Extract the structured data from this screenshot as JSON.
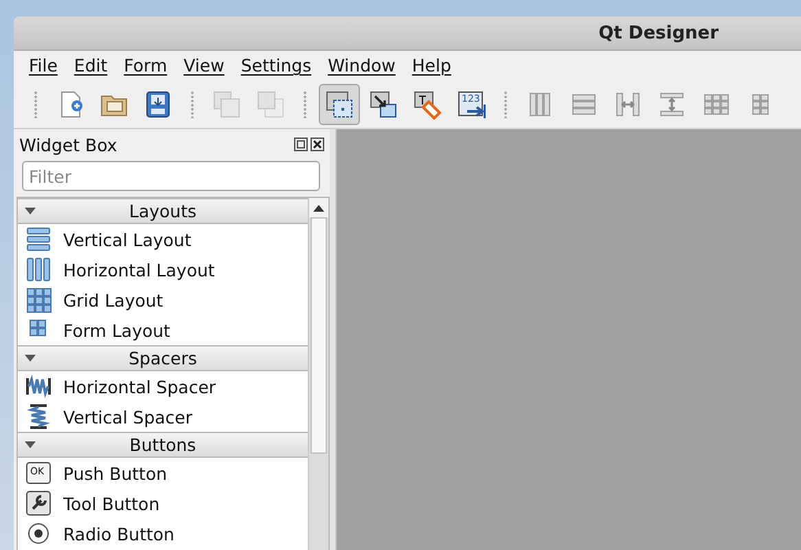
{
  "window": {
    "title": "Qt Designer"
  },
  "menu": [
    "File",
    "Edit",
    "Form",
    "View",
    "Settings",
    "Window",
    "Help"
  ],
  "toolbar": [
    {
      "kind": "new-form",
      "selected": false,
      "disabled": false
    },
    {
      "kind": "open",
      "selected": false,
      "disabled": false
    },
    {
      "kind": "save",
      "selected": false,
      "disabled": false
    },
    {
      "kind": "separator"
    },
    {
      "kind": "bring-front",
      "selected": false,
      "disabled": true
    },
    {
      "kind": "send-back",
      "selected": false,
      "disabled": true
    },
    {
      "kind": "separator"
    },
    {
      "kind": "edit-widgets",
      "selected": true,
      "disabled": false
    },
    {
      "kind": "edit-signals",
      "selected": false,
      "disabled": false
    },
    {
      "kind": "edit-buddies",
      "selected": false,
      "disabled": false
    },
    {
      "kind": "tab-order",
      "selected": false,
      "disabled": false,
      "icon_text": "123"
    },
    {
      "kind": "separator"
    },
    {
      "kind": "layout-h",
      "selected": false,
      "disabled": true
    },
    {
      "kind": "layout-v",
      "selected": false,
      "disabled": true
    },
    {
      "kind": "split-h",
      "selected": false,
      "disabled": true
    },
    {
      "kind": "split-v",
      "selected": false,
      "disabled": true
    },
    {
      "kind": "layout-grid",
      "selected": false,
      "disabled": true
    },
    {
      "kind": "layout-form",
      "selected": false,
      "disabled": true
    }
  ],
  "widget_box": {
    "title": "Widget Box",
    "filter": {
      "placeholder": "Filter"
    },
    "categories": [
      {
        "name": "Layouts",
        "expanded": true,
        "items": [
          {
            "label": "Vertical Layout",
            "kind": "vlayout"
          },
          {
            "label": "Horizontal Layout",
            "kind": "hlayout"
          },
          {
            "label": "Grid Layout",
            "kind": "grid"
          },
          {
            "label": "Form Layout",
            "kind": "form"
          }
        ]
      },
      {
        "name": "Spacers",
        "expanded": true,
        "items": [
          {
            "label": "Horizontal Spacer",
            "kind": "hspacer"
          },
          {
            "label": "Vertical Spacer",
            "kind": "vspacer"
          }
        ]
      },
      {
        "name": "Buttons",
        "expanded": true,
        "items": [
          {
            "label": "Push Button",
            "kind": "pushbutton",
            "icon_text": "OK"
          },
          {
            "label": "Tool Button",
            "kind": "toolbutton"
          },
          {
            "label": "Radio Button",
            "kind": "radio"
          }
        ]
      }
    ]
  }
}
